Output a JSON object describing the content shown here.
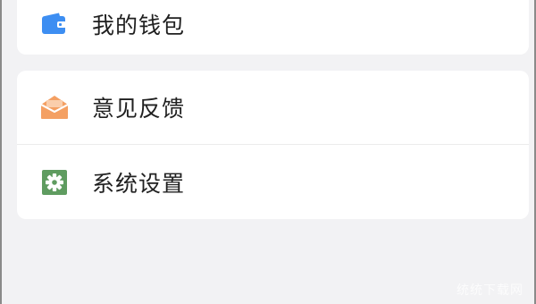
{
  "menu": {
    "wallet": {
      "label": "我的钱包",
      "icon": "wallet-icon",
      "color": "#3d8ef2"
    },
    "feedback": {
      "label": "意见反馈",
      "icon": "envelope-icon",
      "color": "#f4a063"
    },
    "settings": {
      "label": "系统设置",
      "icon": "gear-icon",
      "color": "#5f9c60"
    }
  },
  "watermark": "统统下载网",
  "colors": {
    "background": "#f2f2f4",
    "card": "#ffffff",
    "text": "#202020"
  }
}
